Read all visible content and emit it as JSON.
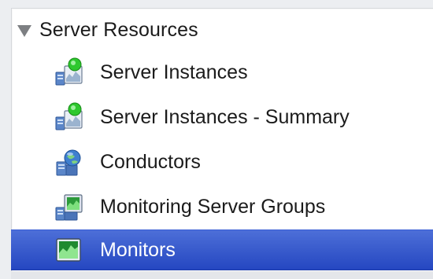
{
  "tree": {
    "group_label": "Server Resources",
    "group_expanded": true,
    "items": [
      {
        "label": "Server Instances",
        "icon": "server-instance-icon",
        "selected": false
      },
      {
        "label": "Server Instances - Summary",
        "icon": "server-instance-summary-icon",
        "selected": false
      },
      {
        "label": "Conductors",
        "icon": "conductor-icon",
        "selected": false
      },
      {
        "label": "Monitoring Server Groups",
        "icon": "monitoring-server-groups-icon",
        "selected": false
      },
      {
        "label": "Monitors",
        "icon": "monitor-icon",
        "selected": true
      }
    ]
  },
  "colors": {
    "selection": "#2f52c9",
    "text": "#1b1b1b",
    "selected_text": "#ffffff",
    "status_green": "#2ec82e"
  }
}
